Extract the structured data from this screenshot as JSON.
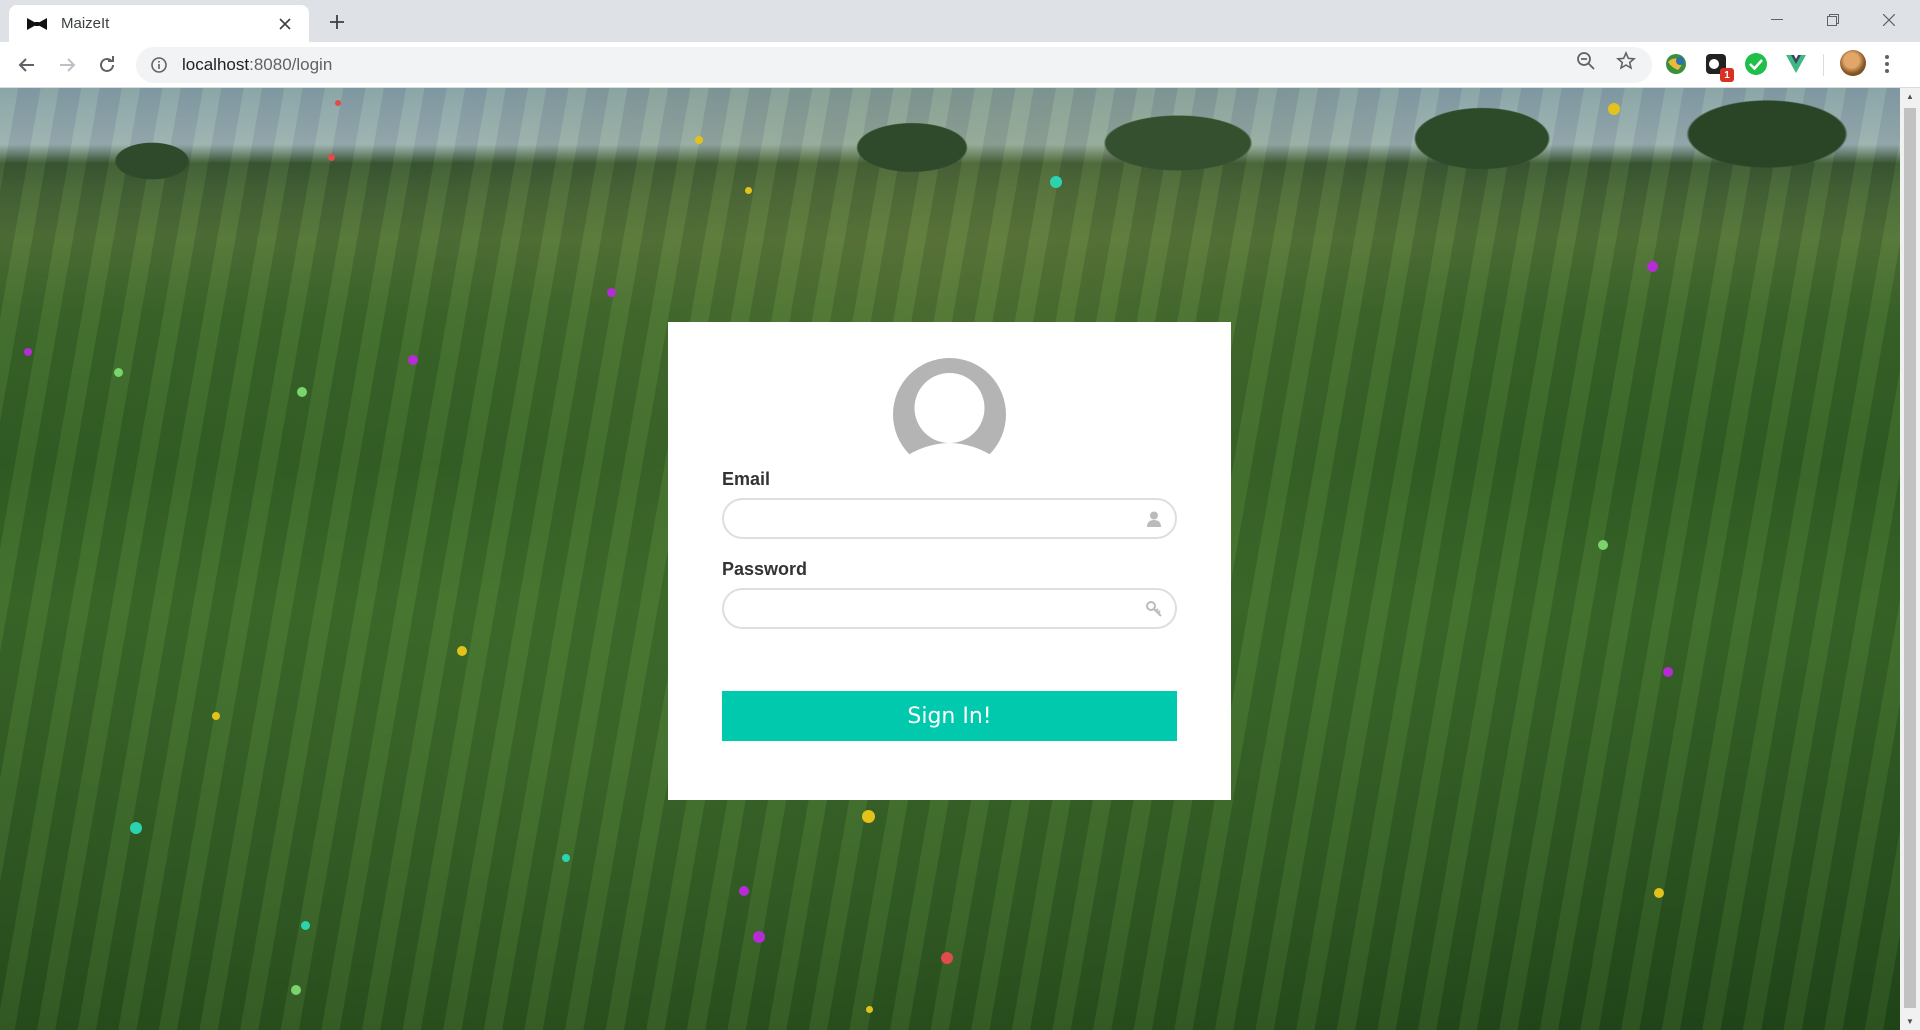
{
  "browser": {
    "tab_title": "MaizeIt",
    "new_tab_icon": "plus-icon",
    "url_host": "localhost",
    "url_rest": ":8080/login",
    "extension_badge": "1"
  },
  "login": {
    "email_label": "Email",
    "email_value": "",
    "password_label": "Password",
    "password_value": "",
    "signin_label": "Sign In!",
    "accent_color": "#00c9ad"
  }
}
